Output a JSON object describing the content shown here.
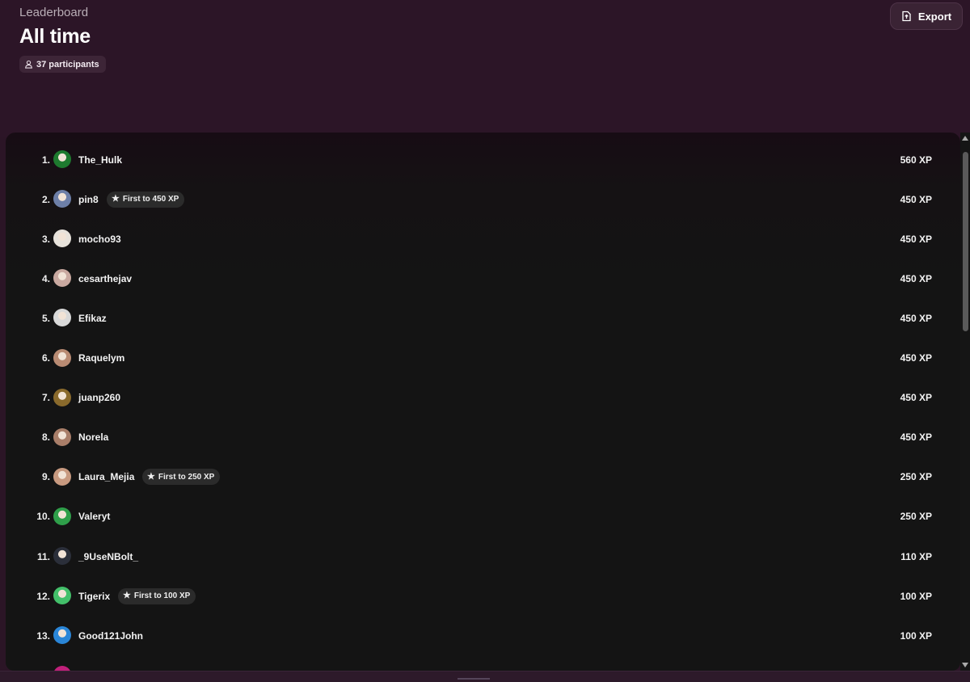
{
  "header": {
    "subtitle": "Leaderboard",
    "title": "All time",
    "participants": "37 participants",
    "export_label": "Export"
  },
  "rows": [
    {
      "rank": "1.",
      "name": "The_Hulk",
      "badge": "",
      "xp": "560 XP",
      "avatar_color": "#1e7a2f"
    },
    {
      "rank": "2.",
      "name": "pin8",
      "badge": "First to 450 XP",
      "xp": "450 XP",
      "avatar_color": "#6d7fa8"
    },
    {
      "rank": "3.",
      "name": "mocho93",
      "badge": "",
      "xp": "450 XP",
      "avatar_color": "#e7e2db"
    },
    {
      "rank": "4.",
      "name": "cesarthejav",
      "badge": "",
      "xp": "450 XP",
      "avatar_color": "#c9a9a0"
    },
    {
      "rank": "5.",
      "name": "Efikaz",
      "badge": "",
      "xp": "450 XP",
      "avatar_color": "#d9d9d9"
    },
    {
      "rank": "6.",
      "name": "Raquelym",
      "badge": "",
      "xp": "450 XP",
      "avatar_color": "#b98b73"
    },
    {
      "rank": "7.",
      "name": "juanp260",
      "badge": "",
      "xp": "450 XP",
      "avatar_color": "#8a6a2c"
    },
    {
      "rank": "8.",
      "name": "Norela",
      "badge": "",
      "xp": "450 XP",
      "avatar_color": "#a97e69"
    },
    {
      "rank": "9.",
      "name": "Laura_Mejia",
      "badge": "First to 250 XP",
      "xp": "250 XP",
      "avatar_color": "#c89a80"
    },
    {
      "rank": "10.",
      "name": "Valeryt",
      "badge": "",
      "xp": "250 XP",
      "avatar_color": "#2f9f4a"
    },
    {
      "rank": "11.",
      "name": "_9UseNBolt_",
      "badge": "",
      "xp": "110 XP",
      "avatar_color": "#2b2f3a"
    },
    {
      "rank": "12.",
      "name": "Tigerix",
      "badge": "First to 100 XP",
      "xp": "100 XP",
      "avatar_color": "#43c06a"
    },
    {
      "rank": "13.",
      "name": "Good121John",
      "badge": "",
      "xp": "100 XP",
      "avatar_color": "#2a86d8"
    }
  ],
  "partial_row_avatar_color": "#c0207a",
  "colors": {
    "header_bg": "#2c1527",
    "panel_bg": "#141414",
    "badge_bg": "#2b2b2b"
  },
  "icons": {
    "participants": "user-icon",
    "export": "file-export-icon",
    "badge": "star-icon"
  }
}
